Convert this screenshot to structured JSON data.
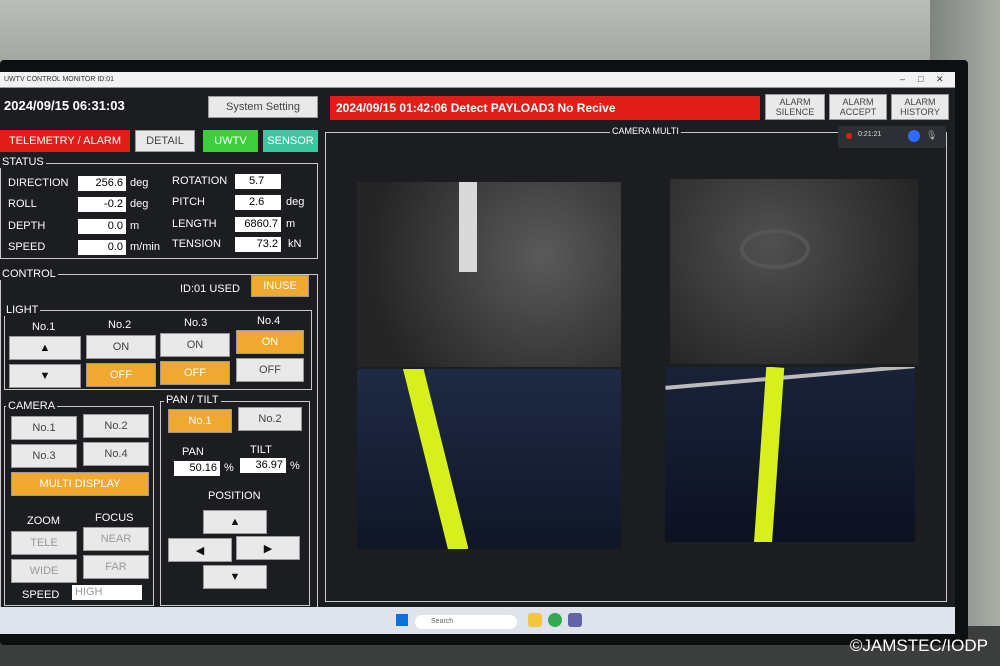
{
  "window": {
    "title": "UWTV CONTROL MONITOR  ID:01"
  },
  "header": {
    "datetime": "2024/09/15 06:31:03",
    "system_setting": "System Setting",
    "alarm_message": "2024/09/15 01:42:06  Detect PAYLOAD3 No Recive",
    "alarm_silence": "ALARM SILENCE",
    "alarm_accept": "ALARM ACCEPT",
    "alarm_history": "ALARM HISTORY"
  },
  "tabs": {
    "telemetry": "TELEMETRY / ALARM",
    "detail": "DETAIL",
    "uwtv": "UWTV",
    "sensor": "SENSOR"
  },
  "status": {
    "title": "STATUS",
    "direction": {
      "label": "DIRECTION",
      "value": "256.6",
      "unit": "deg"
    },
    "roll": {
      "label": "ROLL",
      "value": "-0.2",
      "unit": "deg"
    },
    "depth": {
      "label": "DEPTH",
      "value": "0.0",
      "unit": "m"
    },
    "speed": {
      "label": "SPEED",
      "value": "0.0",
      "unit": "m/min"
    },
    "rotation": {
      "label": "ROTATION",
      "value": "5.7",
      "unit": ""
    },
    "pitch": {
      "label": "PITCH",
      "value": "2.6",
      "unit": "deg"
    },
    "length": {
      "label": "LENGTH",
      "value": "6860.7",
      "unit": "m"
    },
    "tension": {
      "label": "TENSION",
      "value": "73.2",
      "unit": "kN"
    }
  },
  "control": {
    "title": "CONTROL",
    "id_status": "ID:01 USED",
    "inuse": "INUSE"
  },
  "light": {
    "title": "LIGHT",
    "no1": "No.1",
    "no2": "No.2",
    "no3": "No.3",
    "no4": "No.4",
    "up": "▲",
    "down": "▼",
    "on": "ON",
    "off": "OFF"
  },
  "camera": {
    "title": "CAMERA",
    "no1": "No.1",
    "no2": "No.2",
    "no3": "No.3",
    "no4": "No.4",
    "multi": "MULTI DISPLAY",
    "zoom": "ZOOM",
    "focus": "FOCUS",
    "tele": "TELE",
    "wide": "WIDE",
    "near": "NEAR",
    "far": "FAR",
    "speed_label": "SPEED",
    "speed_value": "HIGH"
  },
  "pantilt": {
    "title": "PAN / TILT",
    "no1": "No.1",
    "no2": "No.2",
    "pan_label": "PAN",
    "pan_value": "50.16",
    "pan_unit": "%",
    "tilt_label": "TILT",
    "tilt_value": "36.97",
    "tilt_unit": "%",
    "position": "POSITION",
    "up": "▲",
    "down": "▼",
    "left": "◀",
    "right": "▶"
  },
  "camera_multi": {
    "title": "CAMERA MULTI",
    "rec_time": "0:21:21"
  },
  "taskbar": {
    "search_placeholder": "Search"
  },
  "watermark": "©JAMSTEC/IODP",
  "colors": {
    "alarm_red": "#e01d16",
    "active_orange": "#f0a830",
    "uwtv_green": "#3ccf3c",
    "sensor_teal": "#3dc7a0",
    "rope_yellow": "#d7f01d"
  }
}
